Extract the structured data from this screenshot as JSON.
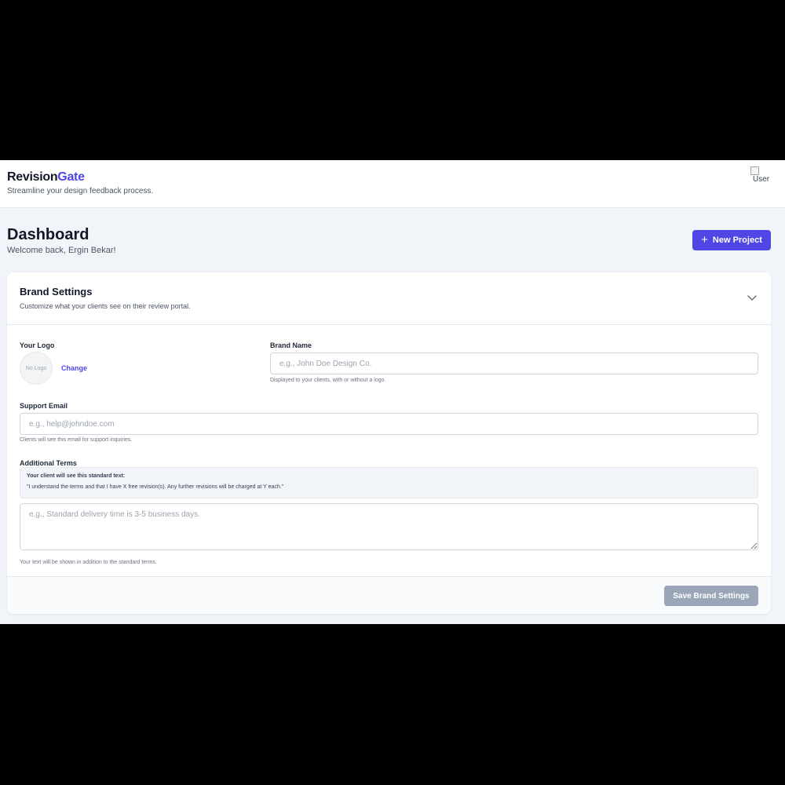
{
  "app": {
    "brand_part1": "Revision",
    "brand_part2": "Gate",
    "tagline": "Streamline your design feedback process.",
    "user_avatar_alt": "User"
  },
  "colors": {
    "accent": "#4f46e5",
    "background": "#f1f4f8",
    "disabled_button": "#9aa5b8"
  },
  "dashboard": {
    "title": "Dashboard",
    "welcome": "Welcome back, Ergin Bekar!",
    "new_project_label": "New Project"
  },
  "brand_settings": {
    "title": "Brand Settings",
    "subtitle": "Customize what your clients see on their review portal.",
    "logo": {
      "label": "Your Logo",
      "placeholder_text": "No Logo",
      "change_label": "Change"
    },
    "brand_name": {
      "label": "Brand Name",
      "value": "",
      "placeholder": "e.g., John Doe Design Co.",
      "help": "Displayed to your clients, with or without a logo."
    },
    "support_email": {
      "label": "Support Email",
      "value": "",
      "placeholder": "e.g., help@johndoe.com",
      "help": "Clients will see this email for support inquiries."
    },
    "additional_terms": {
      "label": "Additional Terms",
      "standard_title": "Your client will see this standard text:",
      "standard_text": "\"I understand the terms and that I have X free revision(s). Any further revisions will be charged at Y each.\"",
      "value": "",
      "placeholder": "e.g., Standard delivery time is 3-5 business days.",
      "help": "Your text will be shown in addition to the standard terms."
    },
    "save_label": "Save Brand Settings"
  }
}
